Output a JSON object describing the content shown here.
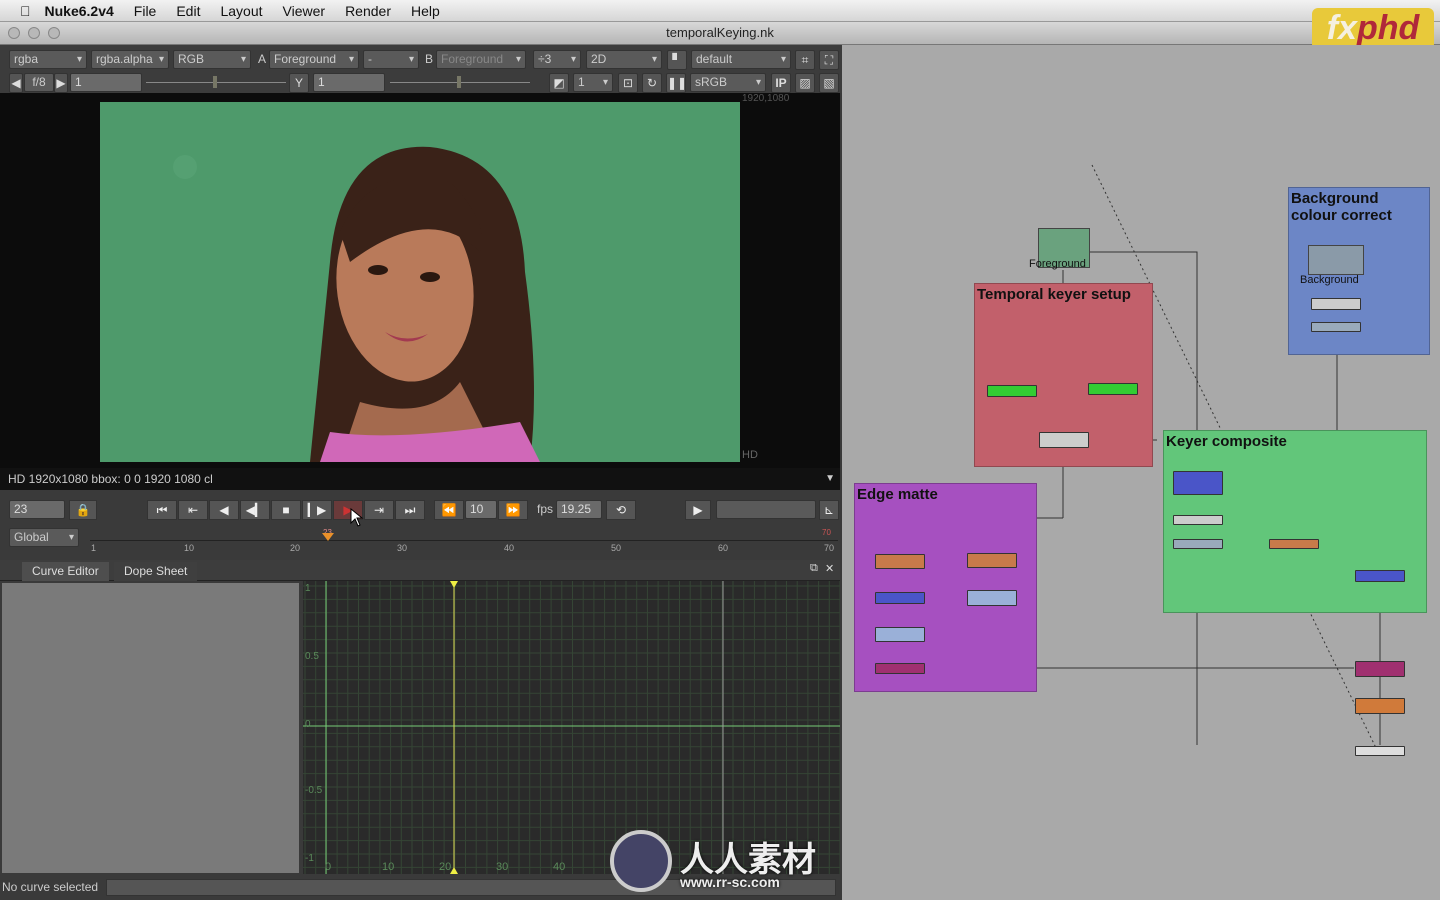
{
  "menubar": {
    "app": "Nuke6.2v4",
    "items": [
      "File",
      "Edit",
      "Layout",
      "Viewer",
      "Render",
      "Help"
    ]
  },
  "window": {
    "title": "temporalKeying.nk"
  },
  "logo": {
    "text_a": "fx",
    "text_b": "phd"
  },
  "viewer_toolbar": {
    "channels": "rgba",
    "alpha": "rgba.alpha",
    "display": "RGB",
    "a_label": "A",
    "a_input": "Foreground",
    "op": "-",
    "b_label": "B",
    "b_input": "Foreground",
    "downrez": "÷3",
    "view_mode": "2D",
    "lut_preset": "default",
    "fstop": "f/8",
    "gain": "1",
    "y_label": "Y",
    "gamma": "1",
    "proxy": "1",
    "colorspace": "sRGB",
    "ip": "IP"
  },
  "viewer": {
    "format_corner": "1920,1080",
    "format_label": "HD",
    "info": "HD 1920x1080 bbox: 0 0 1920 1080 cl"
  },
  "playback": {
    "frame": "23",
    "increment": "10",
    "fps_label": "fps",
    "fps": "19.25",
    "range_mode": "Global",
    "current_marker": "23",
    "end_marker": "70",
    "ticks": [
      "1",
      "10",
      "20",
      "30",
      "40",
      "50",
      "60",
      "70"
    ]
  },
  "tabs": [
    {
      "label": "Curve Editor",
      "active": true
    },
    {
      "label": "Dope Sheet",
      "active": false
    }
  ],
  "curve_editor": {
    "y_ticks": [
      "1",
      "0.5",
      "0",
      "-0.5",
      "-1"
    ],
    "x_ticks": [
      "0",
      "10",
      "20",
      "30",
      "40"
    ],
    "status": "No curve selected"
  },
  "node_graph": {
    "backdrops": [
      {
        "title": "Temporal keyer setup",
        "color": "#c2606b"
      },
      {
        "title": "Background colour correct",
        "color": "#6c86c6"
      },
      {
        "title": "Keyer composite",
        "color": "#62c67a"
      },
      {
        "title": "Edge matte",
        "color": "#a650c0"
      }
    ],
    "reads": [
      "Foreground",
      "Background"
    ]
  },
  "watermark": {
    "text": "人人素材",
    "url": "www.rr-sc.com"
  }
}
